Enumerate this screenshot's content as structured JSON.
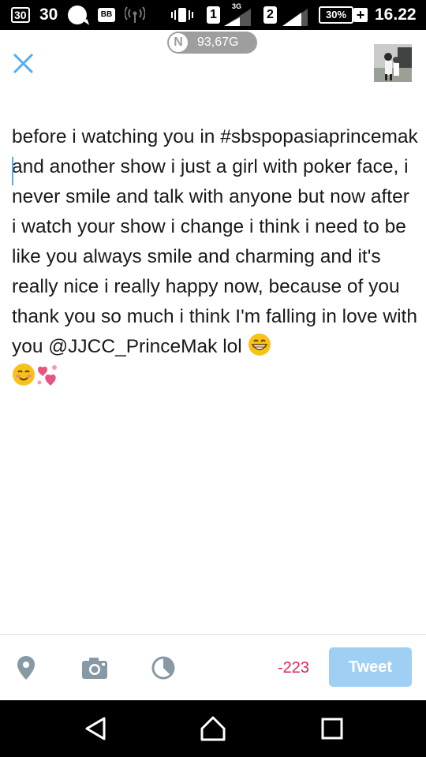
{
  "status_bar": {
    "notif_badge": "30",
    "notif_count": "30",
    "sim1": "1",
    "network": "3G",
    "sim2": "2",
    "battery": "30%",
    "time": "16.22"
  },
  "data_usage": {
    "label": "93,67G"
  },
  "composer": {
    "text": "before i watching you in #sbspopasiaprincemak and another show i just a girl with poker face, i never smile and talk with anyone but now after i watch your show i change i think i need to be like you always smile and charming and it's really nice i really happy now, because of you thank you so much i think I'm falling in love with you @JJCC_PrinceMak lol"
  },
  "toolbar": {
    "char_count": "-223",
    "tweet_label": "Tweet"
  },
  "colors": {
    "accent": "#55acee",
    "tweet_button_disabled": "#9fd0f4",
    "counter_negative": "#e0245e",
    "icon_gray": "#8899a6"
  },
  "icons": {
    "close": "close-icon",
    "location": "location-pin-icon",
    "camera": "camera-icon",
    "gif_or_timer": "pie-chart-icon",
    "back": "back-icon",
    "home": "home-icon",
    "recents": "recents-icon"
  }
}
